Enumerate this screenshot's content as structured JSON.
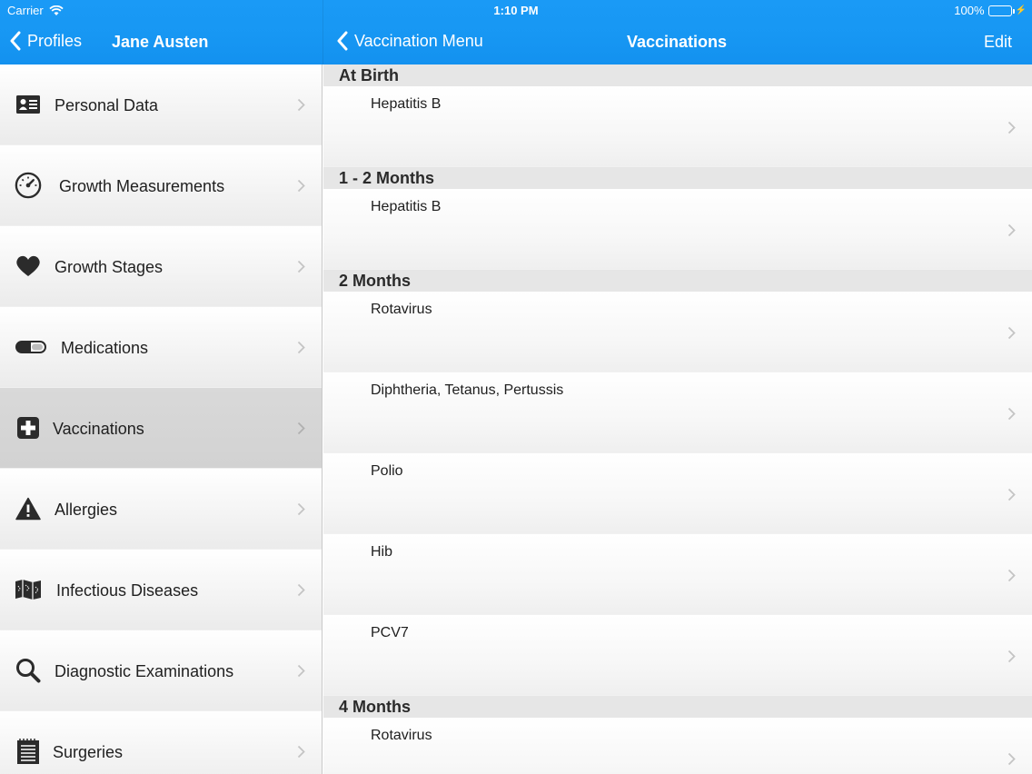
{
  "status_bar": {
    "carrier": "Carrier",
    "time": "1:10 PM",
    "battery": "100%"
  },
  "nav_left": {
    "back_label": "Profiles",
    "title": "Jane Austen"
  },
  "nav_right": {
    "back_label": "Vaccination Menu",
    "title": "Vaccinations",
    "edit_label": "Edit"
  },
  "sidebar": {
    "items": [
      {
        "label": "Personal Data",
        "icon": "id-card-icon"
      },
      {
        "label": "Growth Measurements",
        "icon": "gauge-icon"
      },
      {
        "label": "Growth Stages",
        "icon": "heart-icon"
      },
      {
        "label": "Medications",
        "icon": "pill-icon"
      },
      {
        "label": "Vaccinations",
        "icon": "medical-cross-icon",
        "selected": true
      },
      {
        "label": "Allergies",
        "icon": "warning-icon"
      },
      {
        "label": "Infectious Diseases",
        "icon": "map-icon"
      },
      {
        "label": "Diagnostic Examinations",
        "icon": "search-icon"
      },
      {
        "label": "Surgeries",
        "icon": "notepad-icon"
      }
    ]
  },
  "vaccinations": {
    "sections": [
      {
        "header": "At Birth",
        "rows": [
          "Hepatitis B"
        ]
      },
      {
        "header": "1 - 2 Months",
        "rows": [
          "Hepatitis B"
        ]
      },
      {
        "header": "2 Months",
        "rows": [
          "Rotavirus",
          "Diphtheria, Tetanus, Pertussis",
          "Polio",
          "Hib",
          "PCV7"
        ]
      },
      {
        "header": "4 Months",
        "rows": [
          "Rotavirus"
        ]
      }
    ]
  },
  "colors": {
    "header_blue": "#1797f3",
    "selected_row": "#d4d4d4",
    "section_header": "#e6e6e6"
  }
}
